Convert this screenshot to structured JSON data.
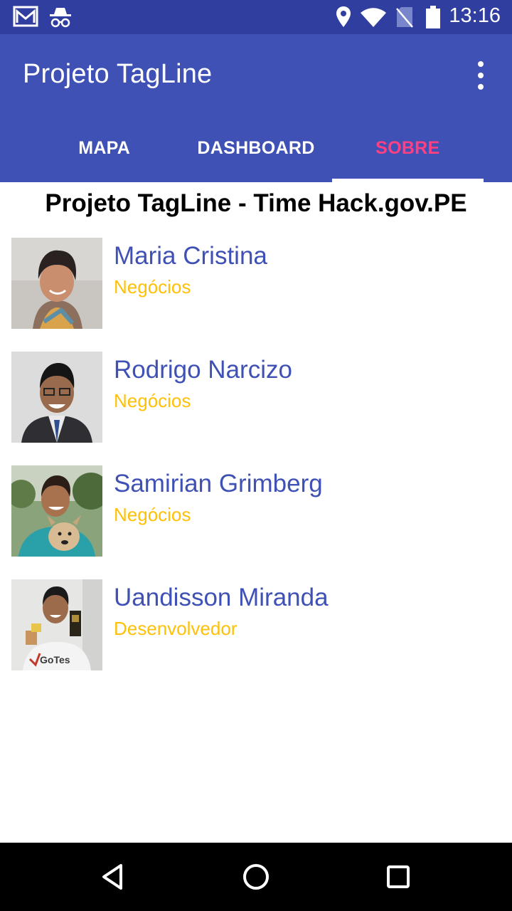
{
  "status_bar": {
    "time": "13:16",
    "left_icons": [
      "gmail-icon",
      "incognito-icon"
    ],
    "right_icons": [
      "location-icon",
      "wifi-icon",
      "no-sim-icon",
      "battery-icon"
    ]
  },
  "app_bar": {
    "title": "Projeto TagLine",
    "overflow_icon": "more-vert-icon"
  },
  "tabs": [
    {
      "label": "MAPA",
      "active": false
    },
    {
      "label": "DASHBOARD",
      "active": false
    },
    {
      "label": "SOBRE",
      "active": true
    }
  ],
  "colors": {
    "primary": "#3f51b5",
    "primary_dark": "#303f9f",
    "accent": "#ff4081",
    "role": "#ffc107"
  },
  "content": {
    "heading": "Projeto TagLine - Time Hack.gov.PE",
    "members": [
      {
        "name": "Maria Cristina",
        "role": "Negócios"
      },
      {
        "name": "Rodrigo Narcizo",
        "role": "Negócios"
      },
      {
        "name": "Samirian Grimberg",
        "role": "Negócios"
      },
      {
        "name": "Uandisson Miranda",
        "role": "Desenvolvedor"
      }
    ]
  },
  "nav_bar": {
    "buttons": [
      "back-icon",
      "home-icon",
      "recents-icon"
    ]
  }
}
